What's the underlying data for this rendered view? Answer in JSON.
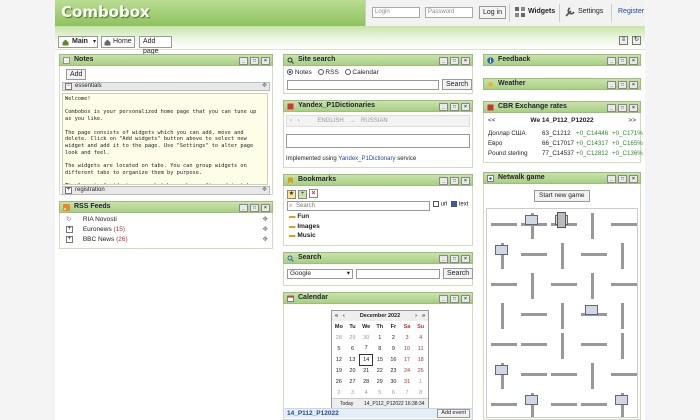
{
  "header": {
    "logo": "Combobox",
    "login_placeholder": "Login",
    "password_placeholder": "Password",
    "login_button": "Log in",
    "widgets_label": "Widgets",
    "settings_label": "Settings",
    "register_label": "Register"
  },
  "tabs": {
    "main_label": "Main",
    "home_label": "Home",
    "add_page_label": "Add page"
  },
  "notes": {
    "title": "Notes",
    "add_button": "Add",
    "section_essentials": "essentials",
    "section_registration": "registration",
    "text": "Welcome!\n\nCombobox is your personalized home page that you can tune up as you like.\n\nThe page consists of widgets which you can add, move and delete. Click on \"Add widgets\" button above to select new widget and add it to the page. Use \"Settings\" to alter page look and feel.\n\nThe widgets are located on tabs. You can group widgets on different tabs to organize them by purpose.\n\nThe layout of widgets on each tab can be configured in tab"
  },
  "rss": {
    "title": "RSS Feeds",
    "items": [
      {
        "name": "RIA Novosti",
        "count": ""
      },
      {
        "name": "Euronews",
        "count": "(15)"
      },
      {
        "name": "BBC News",
        "count": "(26)"
      }
    ]
  },
  "site_search": {
    "title": "Site search",
    "options": [
      "Notes",
      "RSS",
      "Calendar"
    ],
    "button": "Search"
  },
  "dictionaries": {
    "title": "Yandex_P1Dictionaries",
    "from_lang": "ENGLISH",
    "to_lang": "RUSSIAN",
    "footer_prefix": "Implemented using",
    "footer_link": "Yandex_P1Dictionary",
    "footer_suffix": "service"
  },
  "bookmarks": {
    "title": "Bookmarks",
    "search_placeholder": "Search",
    "url_label": "url",
    "text_label": "text",
    "folders": [
      "Fun",
      "Images",
      "Music"
    ]
  },
  "search": {
    "title": "Search",
    "engine": "Google",
    "button": "Search"
  },
  "calendar": {
    "title": "Calendar",
    "month_label": "December 2022",
    "weekdays": [
      "Mo",
      "Tu",
      "We",
      "Th",
      "Fr",
      "Sa",
      "Su"
    ],
    "weeks": [
      [
        "28",
        "29",
        "30",
        "1",
        "2",
        "3",
        "4"
      ],
      [
        "5",
        "6",
        "7",
        "8",
        "9",
        "10",
        "11"
      ],
      [
        "12",
        "13",
        "14",
        "15",
        "16",
        "17",
        "18"
      ],
      [
        "19",
        "20",
        "21",
        "22",
        "23",
        "24",
        "25"
      ],
      [
        "26",
        "27",
        "28",
        "29",
        "30",
        "31",
        "1"
      ],
      [
        "2",
        "3",
        "4",
        "5",
        "6",
        "7",
        "8"
      ]
    ],
    "today_label": "Today",
    "today_value": "14_P112_P12022 16:38:34",
    "selected_date": "14_P112_P12022",
    "add_event": "Add event",
    "nav_prev_year": "«",
    "nav_prev": "‹",
    "nav_next": "›",
    "nav_next_year": "»"
  },
  "feedback": {
    "title": "Feedback"
  },
  "weather": {
    "title": "Weather"
  },
  "cbr": {
    "title": "CBR Exchange rates",
    "prev": "<<",
    "next": ">>",
    "date": "We 14_P112_P12022",
    "rows": [
      {
        "name": "Доллар США",
        "rate": "63_C1212",
        "d1": "+0_C14446",
        "d2": "+0_C171%"
      },
      {
        "name": "Евро",
        "rate": "66_C17017",
        "d1": "+0_C14317",
        "d2": "+0_C165%"
      },
      {
        "name": "Pound sterling",
        "rate": "77_C14537",
        "d1": "+0_C12812",
        "d2": "+0_C136%"
      }
    ]
  },
  "network": {
    "title": "Netwalk game",
    "button": "Start new game"
  },
  "colors": {
    "accent_green": "#a8cf83",
    "link_blue": "#2248a0",
    "positive": "#2b8a2b",
    "count_red": "#b03030"
  }
}
